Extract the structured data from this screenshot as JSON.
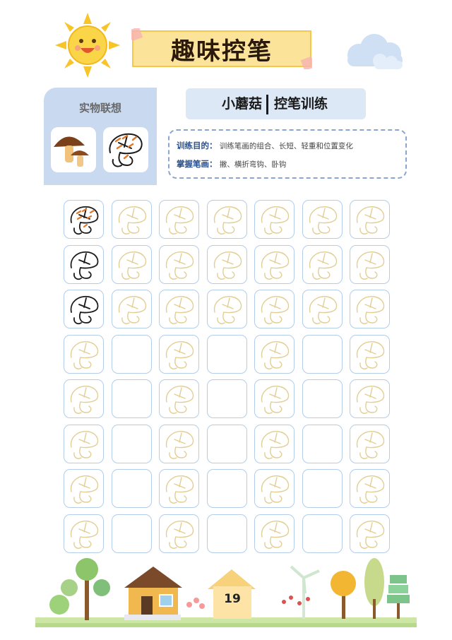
{
  "header": {
    "title": "趣味控笔"
  },
  "reference": {
    "label": "实物联想"
  },
  "subtitle": {
    "name": "小蘑菇",
    "subject": "控笔训练"
  },
  "goals": {
    "purpose_label": "训练目的：",
    "purpose_text": "训练笔画的组合、长短、轻重和位置变化",
    "strokes_label": "掌握笔画：",
    "strokes_text": "撇、横折弯钩、卧钩"
  },
  "grid": {
    "rows": 8,
    "cols": 7,
    "pattern": [
      [
        "colored",
        "trace",
        "trace",
        "trace",
        "trace",
        "trace",
        "trace"
      ],
      [
        "outline",
        "trace",
        "trace",
        "trace",
        "trace",
        "trace",
        "trace"
      ],
      [
        "outline",
        "trace",
        "trace",
        "trace",
        "trace",
        "trace",
        "trace"
      ],
      [
        "trace",
        "empty",
        "trace",
        "empty",
        "trace",
        "empty",
        "trace"
      ],
      [
        "trace",
        "empty",
        "trace",
        "empty",
        "trace",
        "empty",
        "trace"
      ],
      [
        "trace",
        "empty",
        "trace",
        "empty",
        "trace",
        "empty",
        "trace"
      ],
      [
        "trace",
        "empty",
        "trace",
        "empty",
        "trace",
        "empty",
        "trace"
      ],
      [
        "trace",
        "empty",
        "trace",
        "empty",
        "trace",
        "empty",
        "trace"
      ]
    ]
  },
  "colors": {
    "trace": "#e2cd92",
    "outline": "#1a1a1a",
    "accent": "#e07a2a",
    "cell_border": "#b3cdea",
    "panel": "#c9d9f0"
  },
  "footer": {
    "page_number": "19"
  }
}
